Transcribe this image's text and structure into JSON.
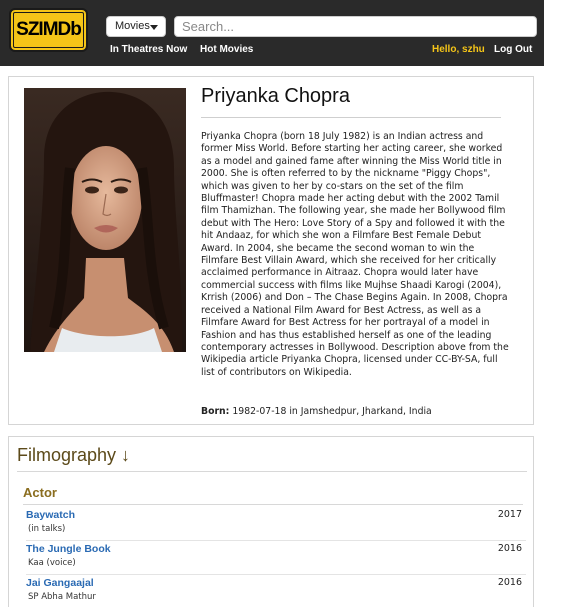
{
  "header": {
    "logo_text": "SZIMDb",
    "search_type": "Movies",
    "search_placeholder": "Search...",
    "nav_links": [
      "In Theatres Now",
      "Hot Movies"
    ],
    "greeting": "Hello, szhu",
    "logout": "Log Out"
  },
  "person": {
    "name": "Priyanka Chopra",
    "photo_icon": "portrait-photo",
    "bio": "Priyanka Chopra (born 18 July 1982) is an Indian actress and former Miss World. Before starting her acting career, she worked as a model and gained fame after winning the Miss World title in 2000. She is often referred to by the nickname \"Piggy Chops\", which was given to her by co-stars on the set of the film Bluffmaster! Chopra made her acting debut with the 2002 Tamil film Thamizhan. The following year, she made her Bollywood film debut with The Hero: Love Story of a Spy and followed it with the hit Andaaz, for which she won a Filmfare Best Female Debut Award. In 2004, she became the second woman to win the Filmfare Best Villain Award, which she received for her critically acclaimed performance in Aitraaz. Chopra would later have commercial success with films like Mujhse Shaadi Karogi (2004), Krrish (2006) and Don – The Chase Begins Again. In 2008, Chopra received a National Film Award for Best Actress, as well as a Filmfare Award for Best Actress for her portrayal of a model in Fashion and has thus established herself as one of the leading contemporary actresses in Bollywood. Description above from the Wikipedia article Priyanka Chopra, licensed under CC-BY-SA, full list of contributors on Wikipedia.",
    "born_label": "Born:",
    "born_value": " 1982-07-18 in Jamshedpur, Jharkand, India"
  },
  "filmography": {
    "title": "Filmography ↓",
    "section": "Actor",
    "entries": [
      {
        "title": "Baywatch",
        "role": "(in talks)",
        "year": "2017"
      },
      {
        "title": "The Jungle Book",
        "role": "Kaa (voice)",
        "year": "2016"
      },
      {
        "title": "Jai Gangaajal",
        "role": "SP Abha Mathur",
        "year": "2016"
      }
    ]
  },
  "colors": {
    "header_bg": "#2a2a2a",
    "logo_yellow": "#f5c518",
    "link_blue": "#2a6ab3",
    "section_gold": "#8a6d1f"
  }
}
